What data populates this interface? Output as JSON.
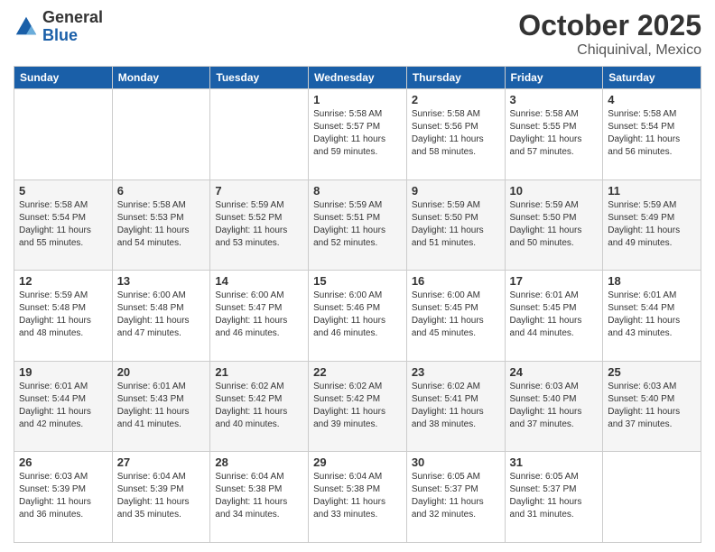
{
  "logo": {
    "general": "General",
    "blue": "Blue"
  },
  "header": {
    "month": "October 2025",
    "location": "Chiquinival, Mexico"
  },
  "days_of_week": [
    "Sunday",
    "Monday",
    "Tuesday",
    "Wednesday",
    "Thursday",
    "Friday",
    "Saturday"
  ],
  "weeks": [
    [
      {
        "day": "",
        "info": ""
      },
      {
        "day": "",
        "info": ""
      },
      {
        "day": "",
        "info": ""
      },
      {
        "day": "1",
        "info": "Sunrise: 5:58 AM\nSunset: 5:57 PM\nDaylight: 11 hours\nand 59 minutes."
      },
      {
        "day": "2",
        "info": "Sunrise: 5:58 AM\nSunset: 5:56 PM\nDaylight: 11 hours\nand 58 minutes."
      },
      {
        "day": "3",
        "info": "Sunrise: 5:58 AM\nSunset: 5:55 PM\nDaylight: 11 hours\nand 57 minutes."
      },
      {
        "day": "4",
        "info": "Sunrise: 5:58 AM\nSunset: 5:54 PM\nDaylight: 11 hours\nand 56 minutes."
      }
    ],
    [
      {
        "day": "5",
        "info": "Sunrise: 5:58 AM\nSunset: 5:54 PM\nDaylight: 11 hours\nand 55 minutes."
      },
      {
        "day": "6",
        "info": "Sunrise: 5:58 AM\nSunset: 5:53 PM\nDaylight: 11 hours\nand 54 minutes."
      },
      {
        "day": "7",
        "info": "Sunrise: 5:59 AM\nSunset: 5:52 PM\nDaylight: 11 hours\nand 53 minutes."
      },
      {
        "day": "8",
        "info": "Sunrise: 5:59 AM\nSunset: 5:51 PM\nDaylight: 11 hours\nand 52 minutes."
      },
      {
        "day": "9",
        "info": "Sunrise: 5:59 AM\nSunset: 5:50 PM\nDaylight: 11 hours\nand 51 minutes."
      },
      {
        "day": "10",
        "info": "Sunrise: 5:59 AM\nSunset: 5:50 PM\nDaylight: 11 hours\nand 50 minutes."
      },
      {
        "day": "11",
        "info": "Sunrise: 5:59 AM\nSunset: 5:49 PM\nDaylight: 11 hours\nand 49 minutes."
      }
    ],
    [
      {
        "day": "12",
        "info": "Sunrise: 5:59 AM\nSunset: 5:48 PM\nDaylight: 11 hours\nand 48 minutes."
      },
      {
        "day": "13",
        "info": "Sunrise: 6:00 AM\nSunset: 5:48 PM\nDaylight: 11 hours\nand 47 minutes."
      },
      {
        "day": "14",
        "info": "Sunrise: 6:00 AM\nSunset: 5:47 PM\nDaylight: 11 hours\nand 46 minutes."
      },
      {
        "day": "15",
        "info": "Sunrise: 6:00 AM\nSunset: 5:46 PM\nDaylight: 11 hours\nand 46 minutes."
      },
      {
        "day": "16",
        "info": "Sunrise: 6:00 AM\nSunset: 5:45 PM\nDaylight: 11 hours\nand 45 minutes."
      },
      {
        "day": "17",
        "info": "Sunrise: 6:01 AM\nSunset: 5:45 PM\nDaylight: 11 hours\nand 44 minutes."
      },
      {
        "day": "18",
        "info": "Sunrise: 6:01 AM\nSunset: 5:44 PM\nDaylight: 11 hours\nand 43 minutes."
      }
    ],
    [
      {
        "day": "19",
        "info": "Sunrise: 6:01 AM\nSunset: 5:44 PM\nDaylight: 11 hours\nand 42 minutes."
      },
      {
        "day": "20",
        "info": "Sunrise: 6:01 AM\nSunset: 5:43 PM\nDaylight: 11 hours\nand 41 minutes."
      },
      {
        "day": "21",
        "info": "Sunrise: 6:02 AM\nSunset: 5:42 PM\nDaylight: 11 hours\nand 40 minutes."
      },
      {
        "day": "22",
        "info": "Sunrise: 6:02 AM\nSunset: 5:42 PM\nDaylight: 11 hours\nand 39 minutes."
      },
      {
        "day": "23",
        "info": "Sunrise: 6:02 AM\nSunset: 5:41 PM\nDaylight: 11 hours\nand 38 minutes."
      },
      {
        "day": "24",
        "info": "Sunrise: 6:03 AM\nSunset: 5:40 PM\nDaylight: 11 hours\nand 37 minutes."
      },
      {
        "day": "25",
        "info": "Sunrise: 6:03 AM\nSunset: 5:40 PM\nDaylight: 11 hours\nand 37 minutes."
      }
    ],
    [
      {
        "day": "26",
        "info": "Sunrise: 6:03 AM\nSunset: 5:39 PM\nDaylight: 11 hours\nand 36 minutes."
      },
      {
        "day": "27",
        "info": "Sunrise: 6:04 AM\nSunset: 5:39 PM\nDaylight: 11 hours\nand 35 minutes."
      },
      {
        "day": "28",
        "info": "Sunrise: 6:04 AM\nSunset: 5:38 PM\nDaylight: 11 hours\nand 34 minutes."
      },
      {
        "day": "29",
        "info": "Sunrise: 6:04 AM\nSunset: 5:38 PM\nDaylight: 11 hours\nand 33 minutes."
      },
      {
        "day": "30",
        "info": "Sunrise: 6:05 AM\nSunset: 5:37 PM\nDaylight: 11 hours\nand 32 minutes."
      },
      {
        "day": "31",
        "info": "Sunrise: 6:05 AM\nSunset: 5:37 PM\nDaylight: 11 hours\nand 31 minutes."
      },
      {
        "day": "",
        "info": ""
      }
    ]
  ]
}
